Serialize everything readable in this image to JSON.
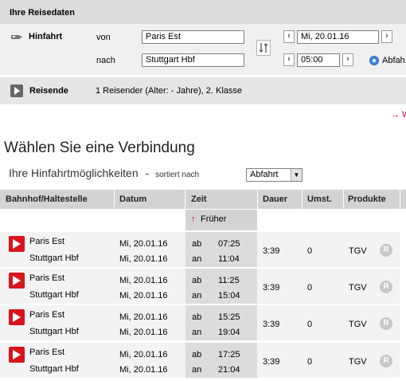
{
  "reisedaten": {
    "title": "Ihre Reisedaten",
    "hinfahrt_label": "Hinfahrt",
    "von_label": "von",
    "nach_label": "nach",
    "von_value": "Paris Est",
    "nach_value": "Stuttgart Hbf",
    "date_value": "Mi, 20.01.16",
    "time_value": "05:00",
    "radio_label": "Abfah",
    "reisende_label": "Reisende",
    "reisende_value": "1 Reisender (Alter: - Jahre), 2. Klasse",
    "link_glyph": "→ W"
  },
  "heading": "Wählen Sie eine Verbindung",
  "subheading": "Ihre Hinfahrtmöglichkeiten",
  "subheading_dash": "-",
  "sort_label": "sortiert nach",
  "sort_value": "Abfahrt",
  "table": {
    "headers": [
      "Bahnhof/Haltestelle",
      "Datum",
      "Zeit",
      "Dauer",
      "Umst.",
      "Produkte"
    ],
    "earlier": "Früher",
    "ab": "ab",
    "an": "an",
    "badge": "R",
    "rows": [
      {
        "from": "Paris Est",
        "to": "Stuttgart Hbf",
        "date1": "Mi, 20.01.16",
        "date2": "Mi, 20.01.16",
        "dep": "07:25",
        "arr": "11:04",
        "dauer": "3:39",
        "umst": "0",
        "produkt": "TGV"
      },
      {
        "from": "Paris Est",
        "to": "Stuttgart Hbf",
        "date1": "Mi, 20.01.16",
        "date2": "Mi, 20.01.16",
        "dep": "11:25",
        "arr": "15:04",
        "dauer": "3:39",
        "umst": "0",
        "produkt": "TGV"
      },
      {
        "from": "Paris Est",
        "to": "Stuttgart Hbf",
        "date1": "Mi, 20.01.16",
        "date2": "Mi, 20.01.16",
        "dep": "15:25",
        "arr": "19:04",
        "dauer": "3:39",
        "umst": "0",
        "produkt": "TGV"
      },
      {
        "from": "Paris Est",
        "to": "Stuttgart Hbf",
        "date1": "Mi, 20.01.16",
        "date2": "Mi, 20.01.16",
        "dep": "17:25",
        "arr": "21:04",
        "dauer": "3:39",
        "umst": "0",
        "produkt": "TGV"
      }
    ]
  },
  "colors": {
    "db_red": "#d8141c",
    "panel_gray": "#f0f0f0",
    "radio_blue": "#3b86e0"
  },
  "icons": [
    "train-icon",
    "swap-icon",
    "chevron-left-icon",
    "chevron-right-icon",
    "db-logo-icon",
    "arrow-up-icon",
    "arrow-right-icon"
  ]
}
